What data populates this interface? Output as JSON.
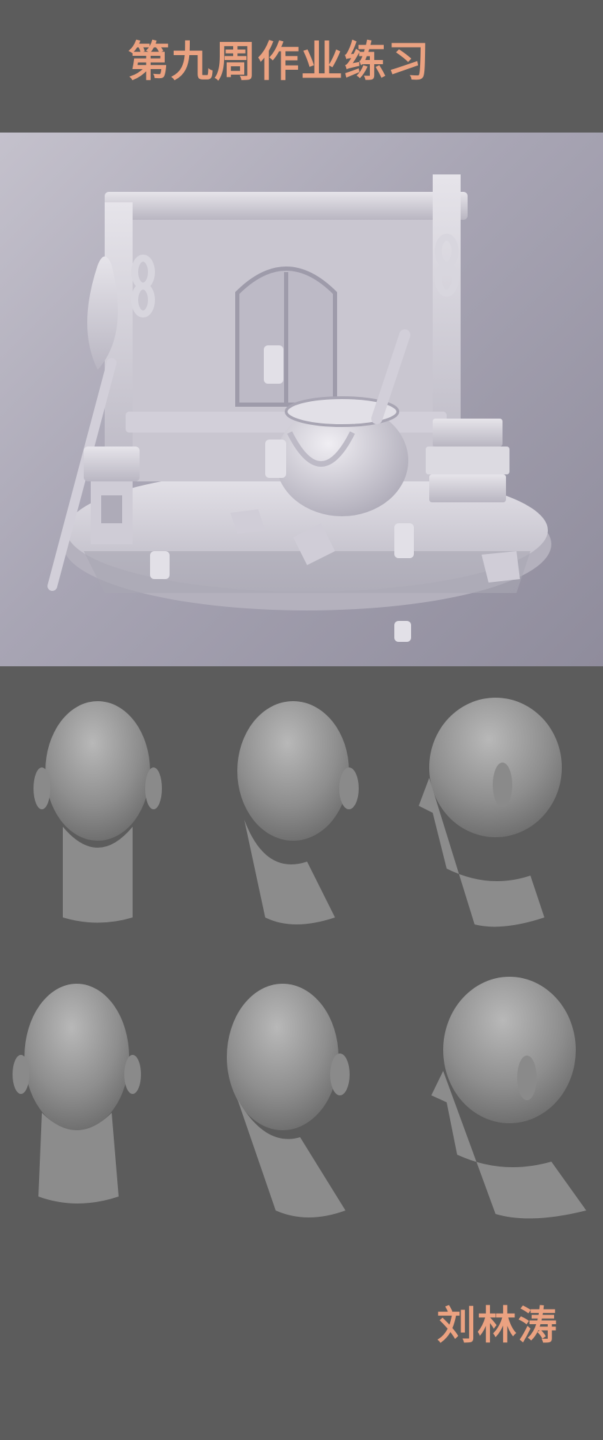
{
  "header": {
    "title": "第九周作业练习"
  },
  "footer": {
    "author": "刘林涛"
  },
  "colors": {
    "background": "#5c5c5c",
    "title_text": "#eba281",
    "clay": "#d6d4dc",
    "head_clay": "#9a9a9a"
  },
  "icons": [
    "witch-hut-sculpt-icon",
    "head-sculpt-icon"
  ]
}
